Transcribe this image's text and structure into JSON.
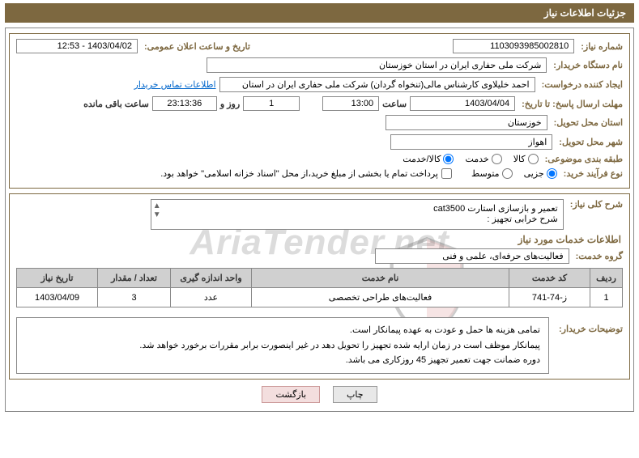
{
  "header": {
    "title": "جزئیات اطلاعات نیاز"
  },
  "need": {
    "number_label": "شماره نیاز:",
    "number": "1103093985002810",
    "announce_label": "تاریخ و ساعت اعلان عمومی:",
    "announce": "1403/04/02 - 12:53"
  },
  "buyer": {
    "label": "نام دستگاه خریدار:",
    "value": "شرکت ملی حفاری ایران در استان خوزستان"
  },
  "requester": {
    "label": "ایجاد کننده درخواست:",
    "value": "احمد خلیلاوی کارشناس مالی(تنخواه گردان) شرکت ملی حفاری ایران در استان",
    "contact_link": "اطلاعات تماس خریدار"
  },
  "deadline": {
    "label": "مهلت ارسال پاسخ: تا تاریخ:",
    "date": "1403/04/04",
    "time_label": "ساعت",
    "time": "13:00",
    "days": "1",
    "days_label": "روز و",
    "remaining_time": "23:13:36",
    "remaining_label": "ساعت باقی مانده"
  },
  "province": {
    "label": "استان محل تحویل:",
    "value": "خوزستان"
  },
  "city": {
    "label": "شهر محل تحویل:",
    "value": "اهواز"
  },
  "category": {
    "label": "طبقه بندی موضوعی:",
    "opt_kala": "کالا",
    "opt_khadamat": "خدمت",
    "opt_kalakhadamat": "کالا/خدمت"
  },
  "purchase_type": {
    "label": "نوع فرآیند خرید:",
    "opt_jozei": "جزیی",
    "opt_motavaset": "متوسط",
    "checkbox_text": "پرداخت تمام یا بخشی از مبلغ خرید،از محل \"اسناد خزانه اسلامی\" خواهد بود."
  },
  "general": {
    "label": "شرح کلی نیاز:",
    "line1": "تعمیر و بازسازی استارت cat3500",
    "line2": "شرح خرابی تجهیز :"
  },
  "services_section": "اطلاعات خدمات مورد نیاز",
  "service_group": {
    "label": "گروه خدمت:",
    "value": "فعالیت‌های حرفه‌ای، علمی و فنی"
  },
  "table": {
    "headers": [
      "ردیف",
      "کد خدمت",
      "نام خدمت",
      "واحد اندازه گیری",
      "تعداد / مقدار",
      "تاریخ نیاز"
    ],
    "rows": [
      {
        "c1": "1",
        "c2": "ز-74-741",
        "c3": "فعالیت‌های طراحی تخصصی",
        "c4": "عدد",
        "c5": "3",
        "c6": "1403/04/09"
      }
    ]
  },
  "notes": {
    "label": "توضیحات خریدار:",
    "line1": "تمامی هزینه ها حمل و عودت به عهده پیمانکار است.",
    "line2": "پیمانکار موظف است در زمان ارایه شده تجهیز را تحویل دهد در غیر اینصورت برابر مقررات برخورد خواهد شد.",
    "line3": "دوره ضمانت جهت تعمیر تجهیز 45 روزکاری می باشد."
  },
  "buttons": {
    "print": "چاپ",
    "back": "بازگشت"
  },
  "watermark": "AriaTender.net"
}
